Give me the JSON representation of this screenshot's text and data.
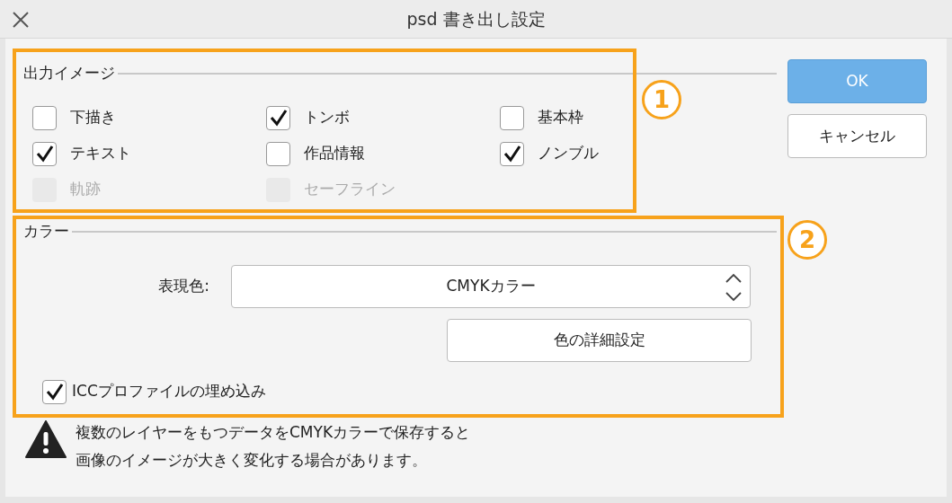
{
  "window": {
    "title": "psd 書き出し設定"
  },
  "output_image": {
    "label": "出力イメージ",
    "options": [
      {
        "label": "下描き",
        "checked": false,
        "disabled": false
      },
      {
        "label": "トンボ",
        "checked": true,
        "disabled": false
      },
      {
        "label": "基本枠",
        "checked": false,
        "disabled": false
      },
      {
        "label": "テキスト",
        "checked": true,
        "disabled": false
      },
      {
        "label": "作品情報",
        "checked": false,
        "disabled": false
      },
      {
        "label": "ノンブル",
        "checked": true,
        "disabled": false
      },
      {
        "label": "軌跡",
        "checked": false,
        "disabled": true
      },
      {
        "label": "セーフライン",
        "checked": false,
        "disabled": true
      }
    ]
  },
  "color": {
    "label": "カラー",
    "mode_label": "表現色:",
    "mode_value": "CMYKカラー",
    "detail_button": "色の詳細設定",
    "embed_icc": {
      "label": "ICCプロファイルの埋め込み",
      "checked": true
    }
  },
  "warning": {
    "lines": [
      "複数のレイヤーをもつデータをCMYKカラーで保存すると",
      "画像のイメージが大きく変化する場合があります。"
    ]
  },
  "buttons": [
    {
      "label": "OK",
      "primary": true
    },
    {
      "label": "キャンセル",
      "primary": false
    }
  ],
  "annotations": [
    {
      "number": "1"
    },
    {
      "number": "2"
    }
  ]
}
